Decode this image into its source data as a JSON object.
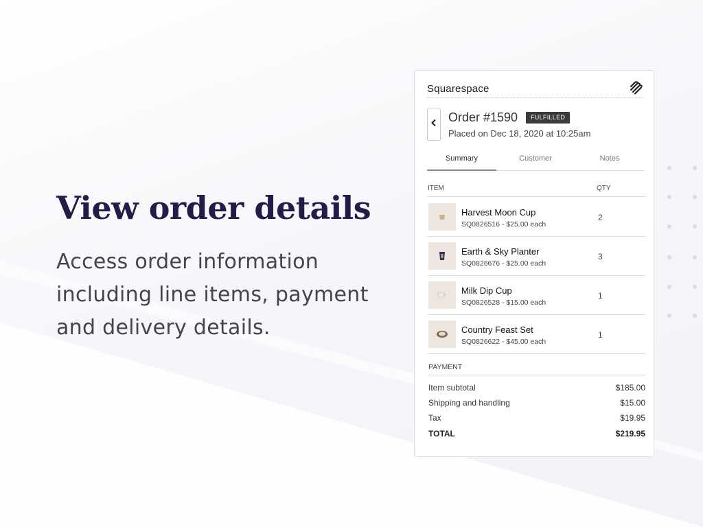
{
  "hero": {
    "title": "View order details",
    "subtitle": "Access order information including line items, payment and delivery details."
  },
  "app": {
    "brand": "Squarespace",
    "logo_icon": "squarespace-logo-icon",
    "back_icon": "chevron-left-icon"
  },
  "order": {
    "title": "Order #1590",
    "status": "FULFILLED",
    "placed": "Placed on Dec 18, 2020 at 10:25am"
  },
  "tabs": [
    {
      "label": "Summary",
      "active": true
    },
    {
      "label": "Customer",
      "active": false
    },
    {
      "label": "Notes",
      "active": false
    }
  ],
  "items": {
    "col_item": "ITEM",
    "col_qty": "QTY",
    "rows": [
      {
        "name": "Harvest Moon Cup",
        "sku": "SQ0826516 - $25.00 each",
        "qty": "2",
        "icon": "cup-icon"
      },
      {
        "name": "Earth & Sky Planter",
        "sku": "SQ0826676 - $25.00 each",
        "qty": "3",
        "icon": "planter-icon"
      },
      {
        "name": "Milk Dip Cup",
        "sku": "SQ0826528 - $15.00 each",
        "qty": "1",
        "icon": "cup-icon"
      },
      {
        "name": "Country Feast Set",
        "sku": "SQ0826622 - $45.00 each",
        "qty": "1",
        "icon": "bowl-icon"
      }
    ]
  },
  "payment": {
    "heading": "PAYMENT",
    "rows": [
      {
        "label": "Item subtotal",
        "amount": "$185.00"
      },
      {
        "label": "Shipping and handling",
        "amount": "$15.00"
      },
      {
        "label": "Tax",
        "amount": "$19.95"
      },
      {
        "label": "TOTAL",
        "amount": "$219.95"
      }
    ]
  },
  "colors": {
    "headline": "#231c47",
    "badge_bg": "#3a3a3a"
  }
}
